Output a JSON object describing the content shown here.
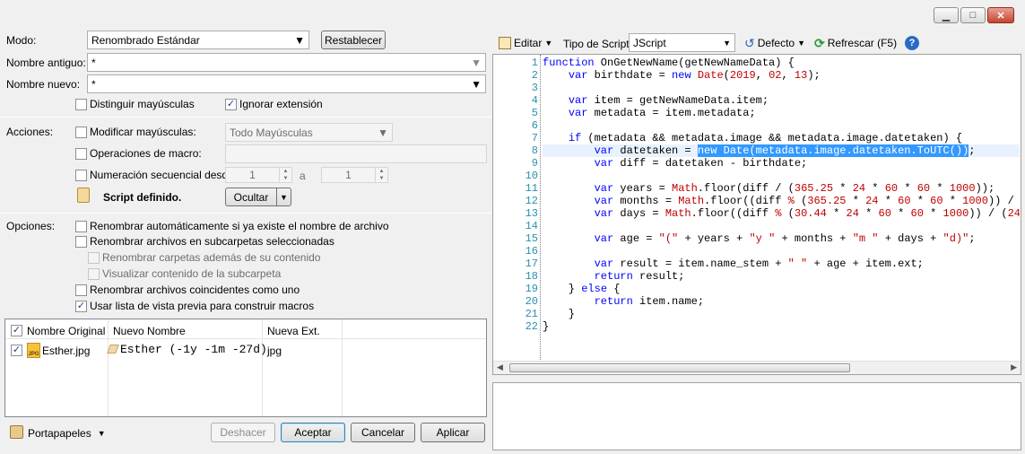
{
  "window": {
    "minimize_glyph": "▁",
    "maximize_glyph": "□",
    "close_glyph": "✕"
  },
  "left": {
    "modo_label": "Modo:",
    "modo_value": "Renombrado Estándar",
    "restablecer_label": "Restablecer",
    "nombre_antiguo_label": "Nombre antiguo:",
    "nombre_antiguo_value": "*",
    "nombre_nuevo_label": "Nombre nuevo:",
    "nombre_nuevo_value": "*",
    "distinguir_label": "Distinguir mayúsculas",
    "ignorar_label": "Ignorar extensión",
    "acciones_label": "Acciones:",
    "modificar_label": "Modificar mayúsculas:",
    "modificar_value": "Todo Mayúsculas",
    "macro_label": "Operaciones de macro:",
    "numeracion_label": "Numeración secuencial desde",
    "num_from": "1",
    "num_a": "a",
    "num_to": "1",
    "script_label": "Script definido.",
    "ocultar_label": "Ocultar",
    "opciones_label": "Opciones:",
    "opt1": "Renombrar automáticamente si ya existe el nombre de archivo",
    "opt2": "Renombrar archivos en subcarpetas seleccionadas",
    "opt3": "Renombrar carpetas además de su contenido",
    "opt4": "Visualizar contenido de la subcarpeta",
    "opt5": "Renombrar archivos coincidentes como uno",
    "opt6": "Usar lista de vista previa para construir macros"
  },
  "preview": {
    "columns": [
      "Nombre Original",
      "Nuevo Nombre",
      "Nueva Ext."
    ],
    "rows": [
      {
        "original": "Esther.jpg",
        "new_name": "Esther (-1y -1m -27d)",
        "ext": "jpg",
        "icon_text": "JPG"
      }
    ]
  },
  "bottom": {
    "portapapeles_label": "Portapapeles",
    "deshacer_label": "Deshacer",
    "aceptar_label": "Aceptar",
    "cancelar_label": "Cancelar",
    "aplicar_label": "Aplicar"
  },
  "toolbar": {
    "editar_label": "Editar",
    "tipo_label": "Tipo de Script",
    "tipo_value": "JScript",
    "defecto_label": "Defecto",
    "refrescar_label": "Refrescar (F5)",
    "help_glyph": "?"
  },
  "code": {
    "line_numbers": [
      "1",
      "2",
      "3",
      "4",
      "5",
      "6",
      "7",
      "8",
      "9",
      "10",
      "11",
      "12",
      "13",
      "14",
      "15",
      "16",
      "17",
      "18",
      "19",
      "20",
      "21",
      "22"
    ]
  },
  "colors": {
    "accent": "#3399ff",
    "keyword": "#0000ff",
    "literal": "#c00000",
    "line_number": "#2b91af"
  }
}
